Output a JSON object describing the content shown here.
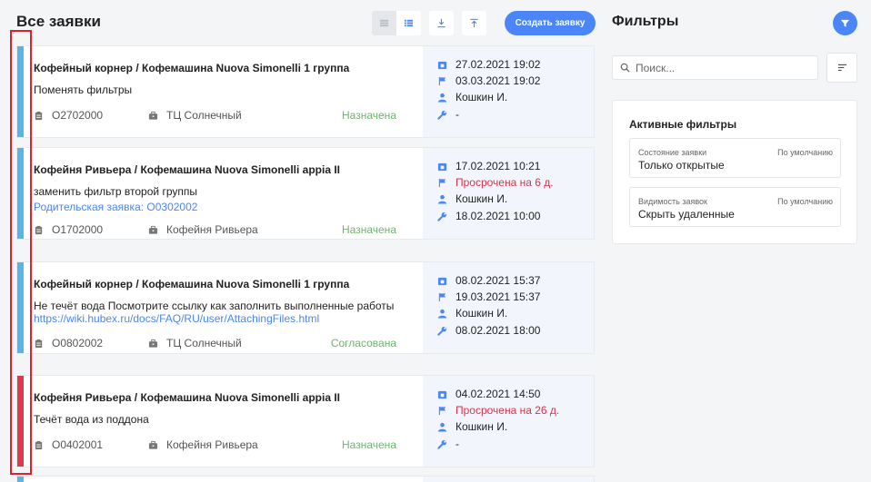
{
  "header": {
    "title": "Все заявки",
    "create_button": "Создать заявку"
  },
  "filters_panel": {
    "title": "Фильтры",
    "search_placeholder": "Поиск...",
    "active_title": "Активные фильтры",
    "items": [
      {
        "label": "Состояние заявки",
        "default": "По умолчанию",
        "value": "Только открытые"
      },
      {
        "label": "Видимость заявок",
        "default": "По умолчанию",
        "value": "Скрыть удаленные"
      }
    ]
  },
  "colors": {
    "accent": "#4a86f7",
    "stripe_blue": "#5ab4e6",
    "stripe_red": "#e0384e",
    "status_green": "#6fb36f",
    "overdue_red": "#d9334a"
  },
  "cards": [
    {
      "title": "Кофейный корнер / Кофемашина Nuova Simonelli 1 группа",
      "description": "Поменять фильтры",
      "link": "",
      "number": "O2702000",
      "location": "ТЦ Солнечный",
      "status": "Назначена",
      "created": "27.02.2021 19:02",
      "deadline": "03.03.2021 19:02",
      "assignee": "Кошкин И.",
      "work_time": "-"
    },
    {
      "title": "Кофейня Ривьера / Кофемашина Nuova Simonelli appia II",
      "description": "заменить фильтр второй группы",
      "link": "Родительская заявка: O0302002",
      "number": "O1702000",
      "location": "Кофейня Ривьера",
      "status": "Назначена",
      "created": "17.02.2021 10:21",
      "deadline": "Просрочена на 6 д.",
      "assignee": "Кошкин И.",
      "work_time": "18.02.2021 10:00"
    },
    {
      "title": "Кофейный корнер / Кофемашина Nuova Simonelli 1 группа",
      "description": "Не течёт вода Посмотрите ссылку как заполнить выполненные работы",
      "link": "https://wiki.hubex.ru/docs/FAQ/RU/user/AttachingFiles.html",
      "number": "O0802002",
      "location": "ТЦ Солнечный",
      "status": "Согласована",
      "created": "08.02.2021 15:37",
      "deadline": "19.03.2021 15:37",
      "assignee": "Кошкин И.",
      "work_time": "08.02.2021 18:00"
    },
    {
      "title": "Кофейня Ривьера / Кофемашина Nuova Simonelli appia II",
      "description": "Течёт вода из поддона",
      "link": "",
      "number": "O0402001",
      "location": "Кофейня Ривьера",
      "status": "Назначена",
      "created": "04.02.2021 14:50",
      "deadline": "Просрочена на 26 д.",
      "assignee": "Кошкин И.",
      "work_time": "-"
    }
  ]
}
